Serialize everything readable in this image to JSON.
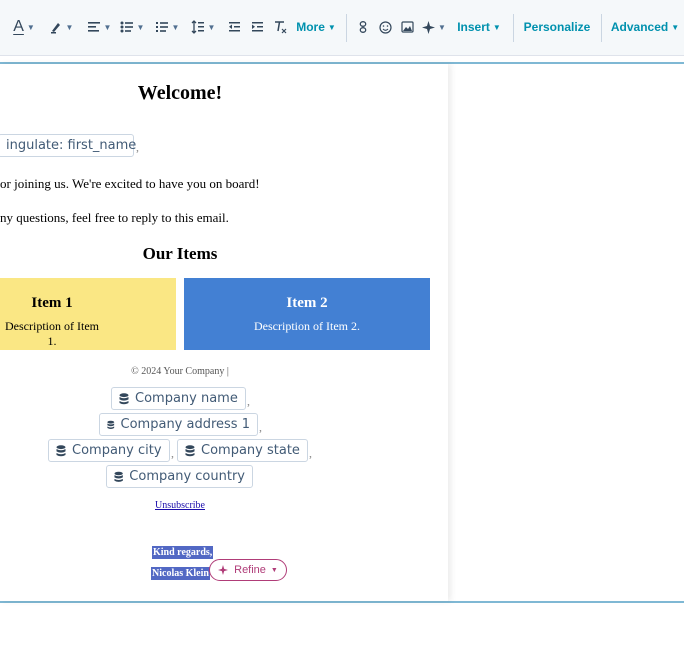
{
  "toolbar": {
    "font_color_letter": "A",
    "more_label": "More",
    "insert_label": "Insert",
    "personalize_label": "Personalize",
    "advanced_label": "Advanced"
  },
  "email": {
    "heading": "Welcome!",
    "greeting_token": "ingulate: first_name",
    "greeting_comma": ",",
    "line1": "or joining us. We're excited to have you on board!",
    "line2": "ny questions, feel free to reply to this email.",
    "items_heading": "Our Items",
    "items": [
      {
        "title": "Item 1",
        "description": "Description of Item 1.",
        "color": "#fae784"
      },
      {
        "title": "Item 2",
        "description": "Description of Item 2.",
        "color": "#4380d3"
      }
    ],
    "footer_copyright": "© 2024 Your Company |",
    "tokens": {
      "company_name": "Company name",
      "company_address": "Company address 1",
      "company_city": "Company city",
      "company_state": "Company state",
      "company_country": "Company country"
    },
    "separator": ",",
    "unsubscribe": "Unsubscribe",
    "signoff": "Kind regards,",
    "signature": "Nicolas Klein"
  },
  "refine": {
    "label": "Refine"
  },
  "colors": {
    "accent": "#0091ae",
    "frame_border": "#7fb8d4",
    "selection": "#5268c4",
    "refine": "#b03c78"
  }
}
